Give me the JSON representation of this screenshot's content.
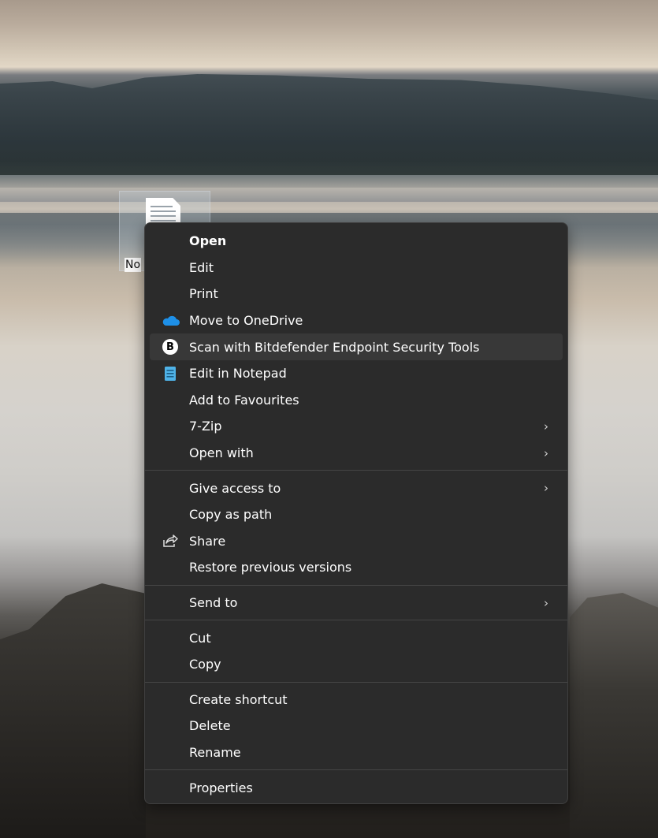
{
  "desktop": {
    "icon_label": "No"
  },
  "menu": {
    "items": [
      {
        "label": "Open",
        "icon": "",
        "bold": true,
        "submenu": false
      },
      {
        "label": "Edit",
        "icon": "",
        "submenu": false
      },
      {
        "label": "Print",
        "icon": "",
        "submenu": false
      },
      {
        "label": "Move to OneDrive",
        "icon": "onedrive-cloud-icon",
        "submenu": false
      },
      {
        "label": "Scan with Bitdefender Endpoint Security Tools",
        "icon": "bitdefender-icon",
        "icon_letter": "B",
        "submenu": false,
        "highlighted": true
      },
      {
        "label": "Edit in Notepad",
        "icon": "notepad-icon",
        "submenu": false
      },
      {
        "label": "Add to Favourites",
        "icon": "",
        "submenu": false
      },
      {
        "label": "7-Zip",
        "icon": "",
        "submenu": true
      },
      {
        "label": "Open with",
        "icon": "",
        "submenu": true
      },
      {
        "label": "Give access to",
        "icon": "",
        "submenu": true
      },
      {
        "label": "Copy as path",
        "icon": "",
        "submenu": false
      },
      {
        "label": "Share",
        "icon": "share-icon",
        "submenu": false
      },
      {
        "label": "Restore previous versions",
        "icon": "",
        "submenu": false
      },
      {
        "label": "Send to",
        "icon": "",
        "submenu": true
      },
      {
        "label": "Cut",
        "icon": "",
        "submenu": false
      },
      {
        "label": "Copy",
        "icon": "",
        "submenu": false
      },
      {
        "label": "Create shortcut",
        "icon": "",
        "submenu": false
      },
      {
        "label": "Delete",
        "icon": "",
        "submenu": false
      },
      {
        "label": "Rename",
        "icon": "",
        "submenu": false
      },
      {
        "label": "Properties",
        "icon": "",
        "submenu": false
      }
    ],
    "chevron": "›"
  },
  "colors": {
    "menu_bg": "#2b2b2b",
    "highlight": "#383838",
    "onedrive": "#1e90e8",
    "notepad": "#4fb3e8"
  }
}
